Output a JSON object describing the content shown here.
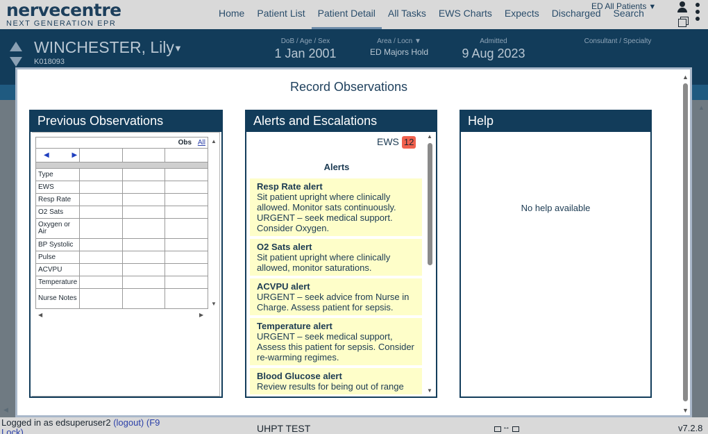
{
  "logo": {
    "name": "nervecentre",
    "subtitle": "NEXT GENERATION EPR"
  },
  "nav": {
    "items": [
      {
        "label": "Home"
      },
      {
        "label": "Patient List"
      },
      {
        "label": "Patient Detail"
      },
      {
        "label": "All Tasks"
      },
      {
        "label": "EWS Charts"
      },
      {
        "label": "Expects"
      },
      {
        "label": "Discharged"
      },
      {
        "label": "Search"
      }
    ],
    "active": "Patient Detail",
    "patient_list": "ED All Patients"
  },
  "patient": {
    "name": "WINCHESTER, Lily",
    "id": "K018093",
    "dob_label": "DoB / Age / Sex",
    "dob": "1 Jan 2001",
    "area_label": "Area / Locn",
    "area": "ED Majors Hold",
    "admitted_label": "Admitted",
    "admitted": "9 Aug 2023",
    "consultant_label": "Consultant / Specialty"
  },
  "modal": {
    "title": "Record Observations",
    "previous": {
      "heading": "Previous Observations",
      "obs_label": "Obs",
      "all_link": "All",
      "rows": [
        "Type",
        "EWS",
        "Resp Rate",
        "O2 Sats",
        "Oxygen or Air",
        "BP Systolic",
        "Pulse",
        "ACVPU",
        "Temperature",
        "Nurse Notes"
      ]
    },
    "alerts": {
      "heading": "Alerts and Escalations",
      "ews_label": "EWS",
      "ews_value": "12",
      "ews_color": "#f0614e",
      "alerts_title": "Alerts",
      "items": [
        {
          "title": "Resp Rate alert",
          "text": "Sit patient upright where clinically allowed. Monitor sats continuously. URGENT – seek medical support. Consider Oxygen."
        },
        {
          "title": "O2 Sats alert",
          "text": "Sit patient upright where clinically allowed, monitor saturations."
        },
        {
          "title": "ACVPU alert",
          "text": "URGENT – seek advice from Nurse in Charge. Assess patient for sepsis."
        },
        {
          "title": "Temperature alert",
          "text": "URGENT – seek medical support, Assess this patient for sepsis. Consider re-warming regimes."
        },
        {
          "title": "Blood Glucose alert",
          "text": "Review results for being out of range"
        }
      ]
    },
    "help": {
      "heading": "Help",
      "text": "No help available"
    }
  },
  "status": {
    "login_prefix": "Logged in as edsuperuser2",
    "logout": "(logout)",
    "lock": "(F9 Lock)",
    "environment": "UHPT TEST",
    "version": "v7.2.8"
  }
}
